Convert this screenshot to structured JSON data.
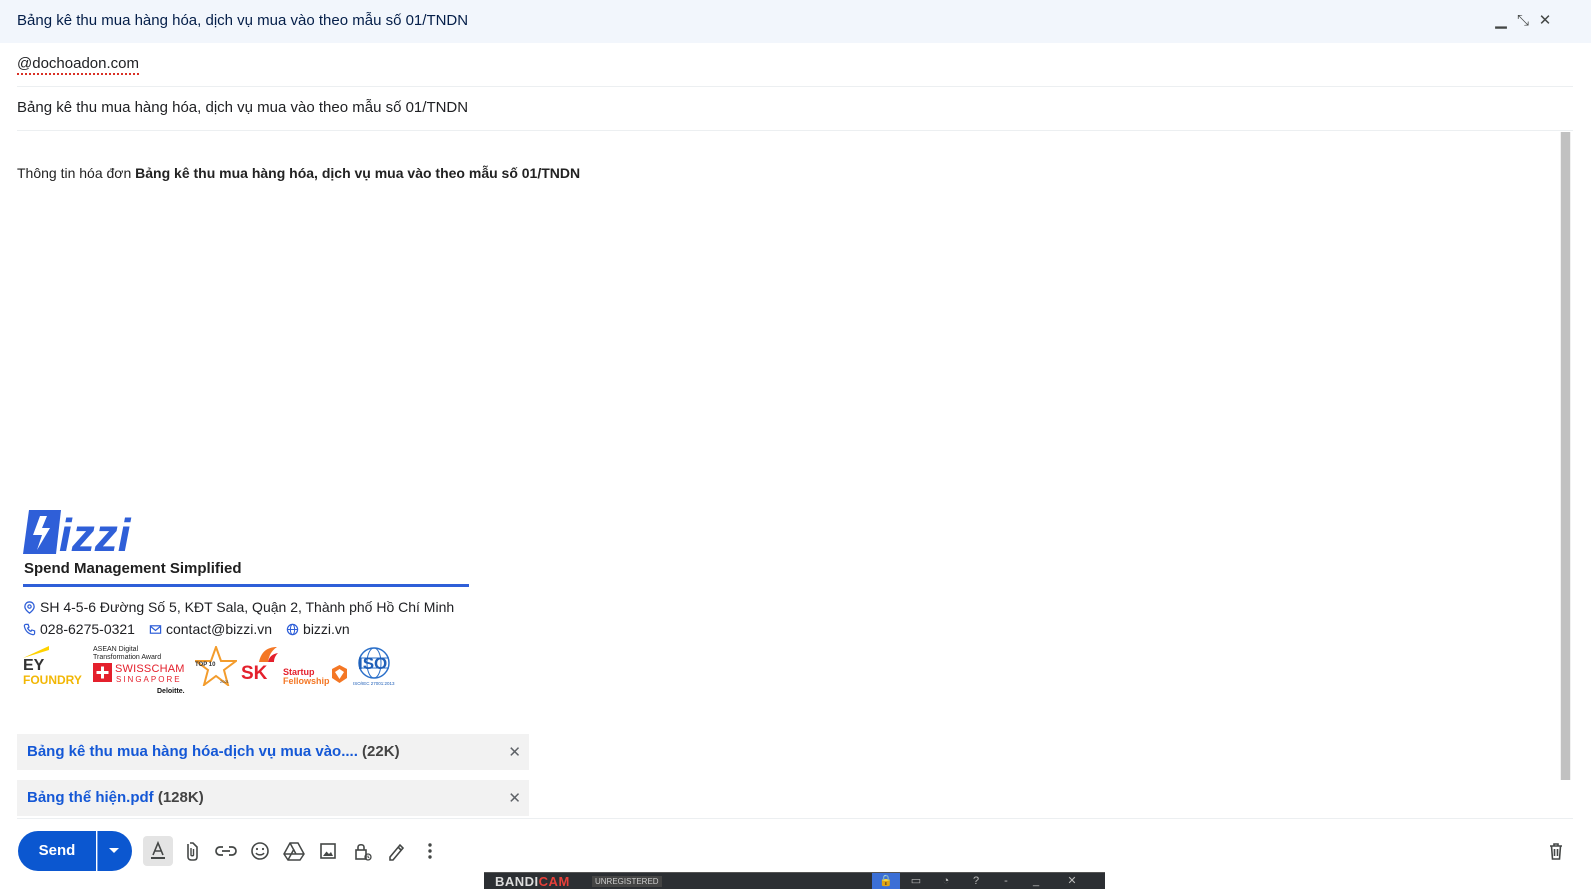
{
  "window": {
    "title": "Bảng kê thu mua hàng hóa, dịch vụ mua vào theo mẫu số 01/TNDN",
    "minimize_glyph": "▁",
    "restore_glyph": "⤡",
    "close_glyph": "✕"
  },
  "recipient": {
    "value": "@dochoadon.com"
  },
  "subject": {
    "value": "Bảng kê thu mua hàng hóa, dịch vụ mua vào theo mẫu số 01/TNDN"
  },
  "message": {
    "prefix": "Thông tin hóa đơn ",
    "bold": "Bảng kê thu mua hàng hóa, dịch vụ mua vào theo mẫu số 01/TNDN"
  },
  "signature": {
    "logo_text": "Bizzi",
    "tagline": "Spend Management Simplified",
    "address": "SH 4-5-6 Đường Số 5, KĐT Sala, Quận 2, Thành phố Hồ Chí Minh",
    "phone": "028-6275-0321",
    "email": "contact@bizzi.vn",
    "website": "bizzi.vn",
    "brand_color": "#2f5fd8",
    "badges": {
      "ey_top": "EY",
      "ey_bottom": "FOUNDRY",
      "asean_line1": "ASEAN Digital",
      "asean_line2": "Transformation Award",
      "swisscham": "SWISSCHAM",
      "singapore": "SINGAPORE",
      "deloitte": "Deloitte.",
      "top10": "TOP 10",
      "top10_year": "2021",
      "sk": "SK",
      "startup_line1": "Startup",
      "startup_line2": "Fellowship",
      "iso": "ISO",
      "iso_sub": "ISO/IEC 27001:2013"
    }
  },
  "attachments": [
    {
      "name": "Bảng kê thu mua hàng hóa-dịch vụ mua vào....",
      "size": " (22K)"
    },
    {
      "name": "Bảng thể hiện.pdf",
      "size": " (128K)"
    }
  ],
  "toolbar": {
    "send_label": "Send",
    "accent_color": "#0b57d0",
    "tools": [
      "formatting-icon",
      "attach-icon",
      "link-icon",
      "emoji-icon",
      "drive-icon",
      "photo-icon",
      "confidential-icon",
      "signature-icon",
      "more-options-icon"
    ],
    "discard_icon": "trash-icon"
  },
  "bandicam": {
    "brand_a": "BANDI",
    "brand_b": "CAM",
    "status": "UNREGISTERED"
  }
}
